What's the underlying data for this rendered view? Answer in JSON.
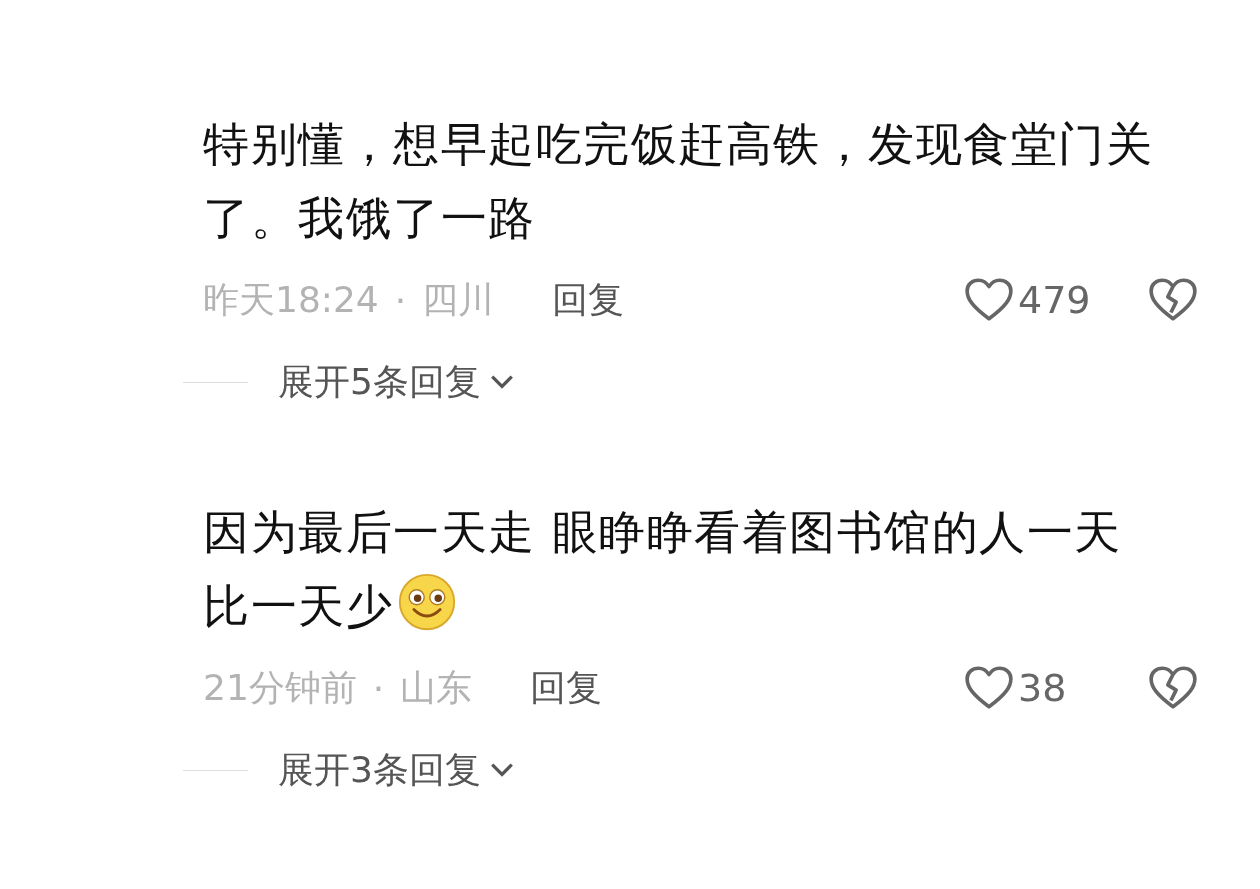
{
  "comments": [
    {
      "lines": [
        "特别懂，想早起吃完饭赶高铁，发现食堂门关",
        "了。我饿了一路"
      ],
      "has_emoji": false,
      "time": "昨天18:24",
      "separator": "·",
      "location": "四川",
      "reply": "回复",
      "likes": "479",
      "expand": "展开5条回复"
    },
    {
      "lines": [
        "因为最后一天走 眼睁睁看着图书馆的人一天",
        "比一天少"
      ],
      "has_emoji": true,
      "time": "21分钟前",
      "separator": "·",
      "location": "山东",
      "reply": "回复",
      "likes": "38",
      "expand": "展开3条回复"
    }
  ]
}
